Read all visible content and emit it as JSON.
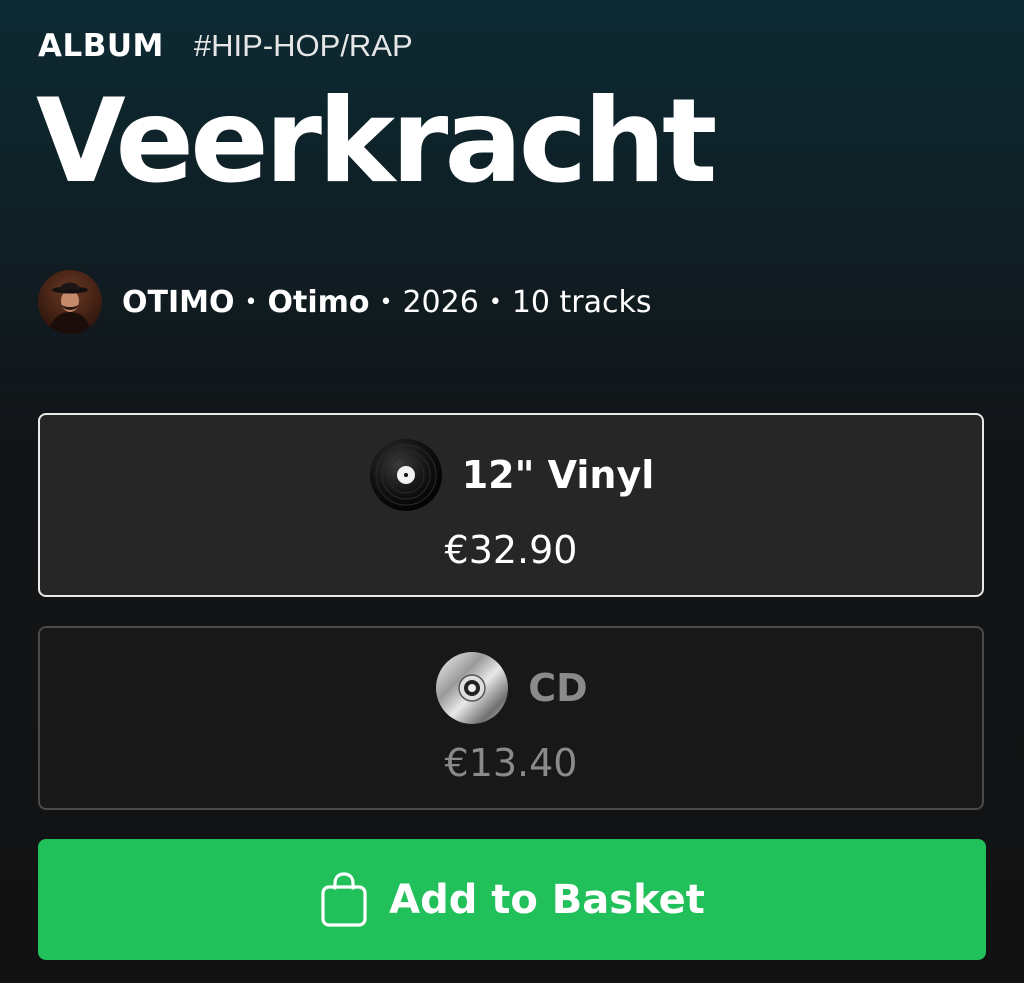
{
  "header": {
    "type_label": "ALBUM",
    "genre": "#HIP-HOP/RAP"
  },
  "album": {
    "title": "Veerkracht"
  },
  "meta": {
    "artist_upper": "OTIMO",
    "separator": "•",
    "artist": "Otimo",
    "year": "2026",
    "tracks": "10 tracks"
  },
  "formats": [
    {
      "name": "12\" Vinyl",
      "price": "€32.90",
      "icon": "vinyl-record-icon",
      "selected": true
    },
    {
      "name": "CD",
      "price": "€13.40",
      "icon": "compact-disc-icon",
      "selected": false
    }
  ],
  "action": {
    "label": "Add to Basket",
    "icon": "shopping-bag-icon",
    "color": "#21c05a"
  },
  "colors": {
    "background_top": "#0d2a33",
    "background_bottom": "#121212",
    "selected_border": "#e9e9e9",
    "unselected_text": "#8a8a8a"
  }
}
